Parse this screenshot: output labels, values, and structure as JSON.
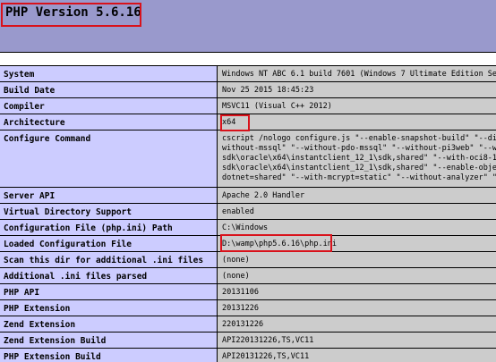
{
  "header": {
    "title": "PHP Version 5.6.16"
  },
  "rows": [
    {
      "key": "System",
      "value": [
        "Windows NT ABC 6.1 build 7601 (Windows 7 Ultimate Edition Service"
      ]
    },
    {
      "key": "Build Date",
      "value": [
        "Nov 25 2015 18:45:23"
      ]
    },
    {
      "key": "Compiler",
      "value": [
        "MSVC11 (Visual C++ 2012)"
      ]
    },
    {
      "key": "Architecture",
      "value": [
        "x64"
      ]
    },
    {
      "key": "Configure Command",
      "value": [
        "cscript /nologo configure.js \"--enable-snapshot-build\" \"--disable",
        "without-mssql\" \"--without-pdo-mssql\" \"--without-pi3web\" \"--with-p",
        "sdk\\oracle\\x64\\instantclient_12_1\\sdk,shared\" \"--with-oci8-12c=c:",
        "sdk\\oracle\\x64\\instantclient_12_1\\sdk,shared\" \"--enable-object-ou",
        "dotnet=shared\" \"--with-mcrypt=static\" \"--without-analyzer\" \"--wit"
      ]
    },
    {
      "key": "Server API",
      "value": [
        "Apache 2.0 Handler"
      ]
    },
    {
      "key": "Virtual Directory Support",
      "value": [
        "enabled"
      ]
    },
    {
      "key": "Configuration File (php.ini) Path",
      "value": [
        "C:\\Windows"
      ]
    },
    {
      "key": "Loaded Configuration File",
      "value": [
        "D:\\wamp\\php5.6.16\\php.ini"
      ]
    },
    {
      "key": "Scan this dir for additional .ini files",
      "value": [
        "(none)"
      ]
    },
    {
      "key": "Additional .ini files parsed",
      "value": [
        "(none)"
      ]
    },
    {
      "key": "PHP API",
      "value": [
        "20131106"
      ]
    },
    {
      "key": "PHP Extension",
      "value": [
        "20131226"
      ]
    },
    {
      "key": "Zend Extension",
      "value": [
        "220131226"
      ]
    },
    {
      "key": "Zend Extension Build",
      "value": [
        "API220131226,TS,VC11"
      ]
    },
    {
      "key": "PHP Extension Build",
      "value": [
        "API20131226,TS,VC11"
      ]
    }
  ],
  "colors": {
    "header_bg": "#9999cc",
    "key_bg": "#ccccff",
    "value_bg": "#cccccc",
    "highlight": "#d9121b"
  }
}
